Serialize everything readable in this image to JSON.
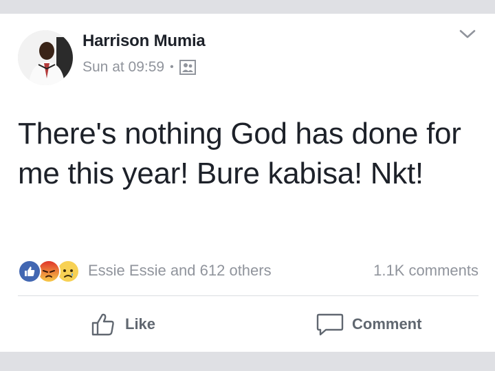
{
  "post": {
    "author": "Harrison Mumia",
    "timestamp": "Sun at 09:59",
    "separator": "•",
    "audience_icon": "friends-icon",
    "text": "There's nothing God has done for me this year! Bure kabisa! Nkt!"
  },
  "reactions": {
    "icons": [
      "like-icon",
      "angry-icon",
      "sad-icon"
    ],
    "summary": "Essie Essie and 612 others",
    "comments": "1.1K comments"
  },
  "actions": {
    "like_label": "Like",
    "comment_label": "Comment"
  },
  "colors": {
    "like_blue": "#4267b2",
    "angry_red": "#e9710f",
    "sad_yellow": "#f7d154",
    "meta_gray": "#90949c"
  }
}
